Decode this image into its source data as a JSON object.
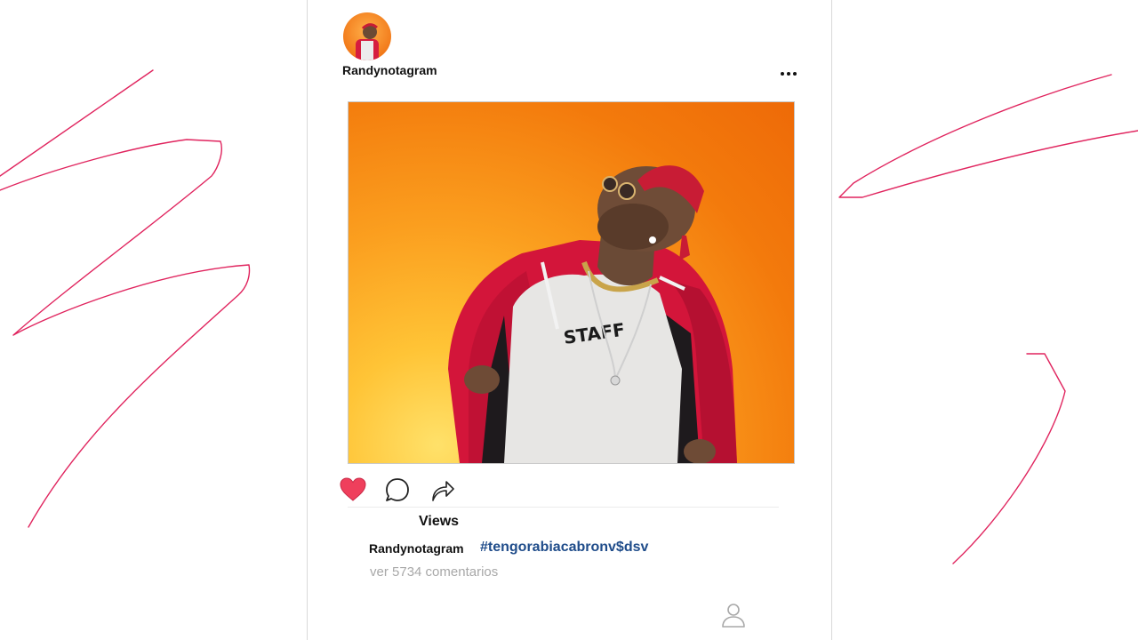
{
  "post": {
    "username": "Randynotagram",
    "photo": {
      "subject": "man in red jacket and bandana",
      "shirt_text": "STAFF"
    },
    "views_label": "Views",
    "caption": {
      "username": "Randynotagram",
      "hashtag": "#tengorabiacabronv$dsv"
    },
    "comments_link": "ver 5734 comentarios",
    "liked": true
  },
  "icons": {
    "more": "more-options-icon",
    "like": "heart-icon",
    "comment": "comment-bubble-icon",
    "share": "share-arrow-icon",
    "profile": "profile-icon"
  },
  "colors": {
    "scribble": "#e0245e",
    "heart_fill": "#ef3f5c",
    "hashtag": "#1f4c8a",
    "muted_text": "#a8a8a8",
    "photo_background": "#f37a0c"
  }
}
